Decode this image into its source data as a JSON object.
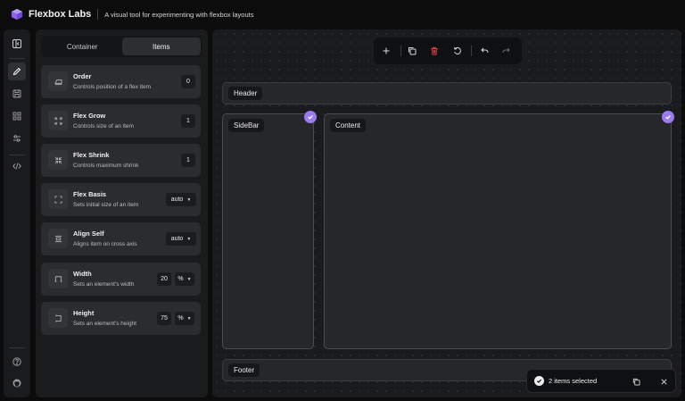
{
  "app": {
    "title": "Flexbox Labs",
    "subtitle": "A visual tool for experimenting with flexbox layouts",
    "accent_color": "#9b7bf0",
    "delete_color": "#e0454c"
  },
  "rail": {
    "items": [
      {
        "icon": "panel-toggle-icon"
      },
      {
        "icon": "pencil-icon",
        "active": true
      },
      {
        "icon": "save-icon"
      },
      {
        "icon": "grid-icon"
      },
      {
        "icon": "sliders-icon"
      },
      {
        "icon": "code-icon"
      }
    ],
    "bottom": [
      {
        "icon": "help-icon"
      },
      {
        "icon": "github-icon"
      }
    ]
  },
  "tabs": {
    "container": "Container",
    "items": "Items",
    "active": "Items"
  },
  "properties": [
    {
      "title": "Order",
      "desc": "Controls position of a flex item",
      "value": "0"
    },
    {
      "title": "Flex Grow",
      "desc": "Controls size of an item",
      "value": "1"
    },
    {
      "title": "Flex Shrink",
      "desc": "Controls maximum shrink",
      "value": "1"
    },
    {
      "title": "Flex Basis",
      "desc": "Sets initial size of an item",
      "value": "auto"
    },
    {
      "title": "Align Self",
      "desc": "Aligns item on cross axis",
      "value": "auto"
    },
    {
      "title": "Width",
      "desc": "Sets an element's width",
      "value": "20",
      "unit": "%"
    },
    {
      "title": "Height",
      "desc": "Sets an element's height",
      "value": "75",
      "unit": "%"
    }
  ],
  "toolbar": [
    "add-icon",
    "duplicate-icon",
    "delete-icon",
    "reset-icon",
    "undo-icon",
    "redo-icon"
  ],
  "canvas": {
    "header": "Header",
    "sidebar": "SideBar",
    "content": "Content",
    "footer": "Footer"
  },
  "toast": {
    "text": "2 items selected"
  }
}
